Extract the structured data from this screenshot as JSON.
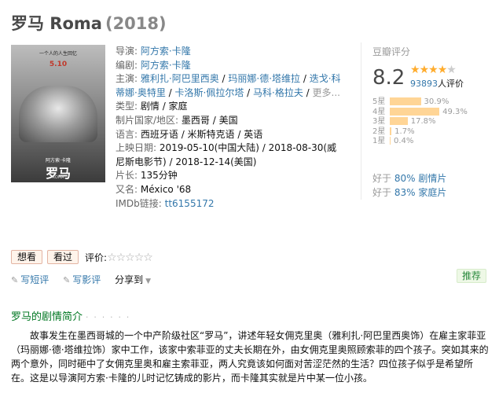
{
  "title": {
    "name": "罗马 Roma",
    "year": "(2018)"
  },
  "poster": {
    "top_text": "一个人的人生回忆",
    "date": "5.10",
    "director_text": "阿方索·卡隆",
    "title": "罗马",
    "subtitle": "ROMA"
  },
  "info": {
    "director_label": "导演:",
    "director": "阿方索·卡隆",
    "writer_label": "编剧:",
    "writer": "阿方索·卡隆",
    "cast_label": "主演:",
    "cast": [
      "雅利扎·阿巴里西奥",
      "玛丽娜·德·塔维拉",
      "迭戈·科蒂娜·奥特里",
      "卡洛斯·佩拉尔塔",
      "马科·格拉夫"
    ],
    "cast_more": "更多...",
    "genre_label": "类型:",
    "genre": "剧情 / 家庭",
    "country_label": "制片国家/地区:",
    "country": "墨西哥 / 美国",
    "language_label": "语言:",
    "language": "西班牙语 / 米斯特克语 / 英语",
    "release_label": "上映日期:",
    "release_1": "2019-05-10(中国大陆)",
    "release_sep": " / ",
    "release_2": "2018-08-30(威尼斯电影节)",
    "release_3": "2018-12-14(美国)",
    "runtime_label": "片长:",
    "runtime": "135分钟",
    "aka_label": "又名:",
    "aka": "México '68",
    "imdb_label": "IMDb链接:",
    "imdb": "tt6155172"
  },
  "rating": {
    "label": "豆瓣评分",
    "score": "8.2",
    "stars_filled": 4,
    "votes": "93893",
    "votes_unit": "人评价",
    "breakdown": [
      {
        "label": "5星",
        "pct": "30.9%",
        "value": 30.9
      },
      {
        "label": "4星",
        "pct": "49.3%",
        "value": 49.3
      },
      {
        "label": "3星",
        "pct": "17.8%",
        "value": 17.8
      },
      {
        "label": "2星",
        "pct": "1.7%",
        "value": 1.7
      },
      {
        "label": "1星",
        "pct": "0.4%",
        "value": 0.4
      }
    ],
    "better_than": [
      {
        "prefix": "好于 ",
        "pct": "80%",
        "category": "剧情片"
      },
      {
        "prefix": "好于 ",
        "pct": "83%",
        "category": "家庭片"
      }
    ]
  },
  "buttons": {
    "want": "想看",
    "seen": "看过",
    "my_rating_label": "评价:"
  },
  "actions": {
    "write_review": "写短评",
    "write_long_review": "写影评",
    "share": "分享到",
    "recommend": "推荐"
  },
  "synopsis": {
    "title": "罗马的剧情简介",
    "dots": "· · · · · ·",
    "text": "故事发生在墨西哥城的一个中产阶级社区“罗马”，讲述年轻女佣克里奥（雅利扎·阿巴里西奥饰）在雇主家菲亚（玛丽娜·德·塔维拉饰）家中工作，该家中索菲亚的丈夫长期在外，由女佣克里奥照顾索菲的四个孩子。突如其来的两个意外，同时砸中了女佣克里奥和雇主索菲亚，两人究竟该如何面对苦涩茫然的生活？四位孩子似乎是希望所在。这是以导演阿方索·卡隆的儿时记忆铸成的影片，而卡隆其实就是片中某一位小孩。"
  },
  "colors": {
    "link": "#3377aa",
    "star": "#ffac2d",
    "bar": "#ffd596",
    "section_title": "#007722"
  }
}
